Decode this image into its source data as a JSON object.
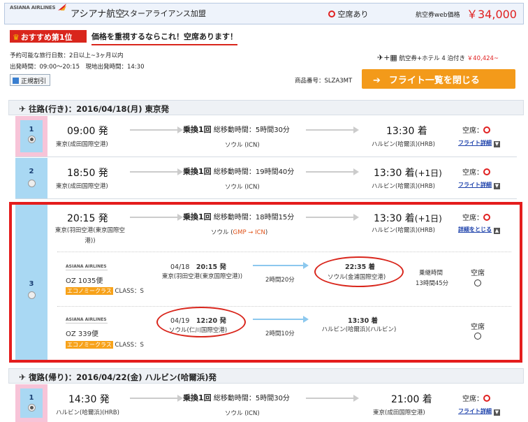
{
  "header": {
    "logo_text": "ASIANA AIRLINES",
    "airline_name": "アシアナ航空",
    "alliance": "スターアライアンス加盟",
    "seat_status": "空席あり",
    "fare_label": "航空券web価格",
    "fare_price": "￥34,000"
  },
  "promo": {
    "badge": "おすすめ第1位",
    "text": "価格を重視するならこれ！空席あります！"
  },
  "info": {
    "line1": "予約可能な旅行日数：2日以上~3ヶ月以内",
    "line2": "出発時間：09:00〜20:15　現地出発時間：14:30",
    "rules_button": "正規割引"
  },
  "package": {
    "text": "航空券+ホテル 4 泊付き",
    "price": "￥40,424~"
  },
  "product_no": "商品番号：SLZA3MT",
  "close_button": "フライト一覧を閉じる",
  "outbound": {
    "title": "往路(行き)：2016/04/18(月) 東京発",
    "flights": [
      {
        "no": "1",
        "dep_time": "09:00 発",
        "dep_airport": "東京(成田国際空港)",
        "transfer": "乗換1回",
        "duration": "総移動時間：5時間30分",
        "via": "ソウル (ICN)",
        "arr_time": "13:30 着",
        "arr_suffix": "",
        "arr_airport": "ハルビン(哈爾浜)(HRB)",
        "seat_label": "空席：",
        "detail_link": "フライト詳細"
      },
      {
        "no": "2",
        "dep_time": "18:50 発",
        "dep_airport": "東京(成田国際空港)",
        "transfer": "乗換1回",
        "duration": "総移動時間：19時間40分",
        "via": "ソウル (ICN)",
        "arr_time": "13:30 着",
        "arr_suffix": "(+1日)",
        "arr_airport": "ハルビン(哈爾浜)(HRB)",
        "seat_label": "空席：",
        "detail_link": "フライト詳細"
      },
      {
        "no": "3",
        "dep_time": "20:15 発",
        "dep_airport": "東京(羽田空港(東京国際空港))",
        "transfer": "乗換1回",
        "duration": "総移動時間：18時間15分",
        "via_prefix": "ソウル (",
        "via_mid": "GMP → ICN",
        "via_suffix": ")",
        "arr_time": "13:30 着",
        "arr_suffix": "(+1日)",
        "arr_airport": "ハルビン(哈爾浜)(HRB)",
        "seat_label": "空席：",
        "detail_link": "詳細をとじる"
      }
    ],
    "segments": [
      {
        "airline": "ASIANA AIRLINES",
        "flight": "OZ 1035便",
        "class_tag": "エコノミークラス",
        "class": "CLASS：S",
        "date": "04/18",
        "dep_time": "20:15 発",
        "dep_airport": "東京(羽田空港(東京国際空港))",
        "duration": "2時間20分",
        "arr_time": "22:35 着",
        "arr_airport": "ソウル(金浦国際空港)",
        "connect_label": "乗継時間",
        "connect_time": "13時間45分",
        "seat": "空席"
      },
      {
        "airline": "ASIANA AIRLINES",
        "flight": "OZ 339便",
        "class_tag": "エコノミークラス",
        "class": "CLASS：S",
        "date": "04/19",
        "dep_time": "12:20 発",
        "dep_airport": "ソウル(仁川国際空港)",
        "duration": "2時間10分",
        "arr_time": "13:30 着",
        "arr_airport": "ハルビン(哈爾浜)(ハルビン)",
        "seat": "空席"
      }
    ]
  },
  "return": {
    "title": "復路(帰り)：2016/04/22(金) ハルビン(哈爾浜)発",
    "flights": [
      {
        "no": "1",
        "dep_time": "14:30 発",
        "dep_airport": "ハルビン(哈爾浜)(HRB)",
        "transfer": "乗換1回",
        "duration": "総移動時間：5時間30分",
        "via": "ソウル (ICN)",
        "arr_time": "21:00 着",
        "arr_airport": "東京(成田国際空港)",
        "seat_label": "空席：",
        "detail_link": "フライト詳細"
      }
    ]
  }
}
